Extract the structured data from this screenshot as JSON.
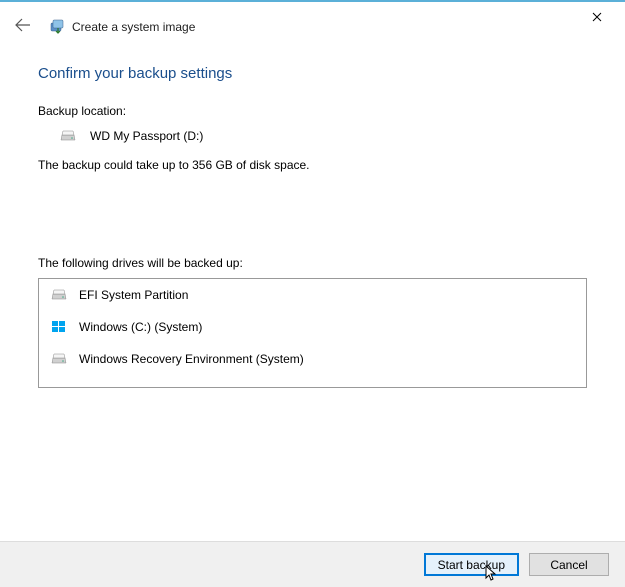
{
  "header": {
    "page_title": "Create a system image"
  },
  "content": {
    "heading": "Confirm your backup settings",
    "backup_location_label": "Backup location:",
    "backup_location_name": "WD My Passport (D:)",
    "disk_space": "The backup could take up to 356 GB of disk space.",
    "drives_label": "The following drives will be backed up:",
    "drives": [
      {
        "name": "EFI System Partition",
        "icon": "hdd"
      },
      {
        "name": "Windows (C:) (System)",
        "icon": "win"
      },
      {
        "name": "Windows Recovery Environment (System)",
        "icon": "hdd"
      }
    ]
  },
  "footer": {
    "start_backup": "Start backup",
    "cancel": "Cancel"
  }
}
